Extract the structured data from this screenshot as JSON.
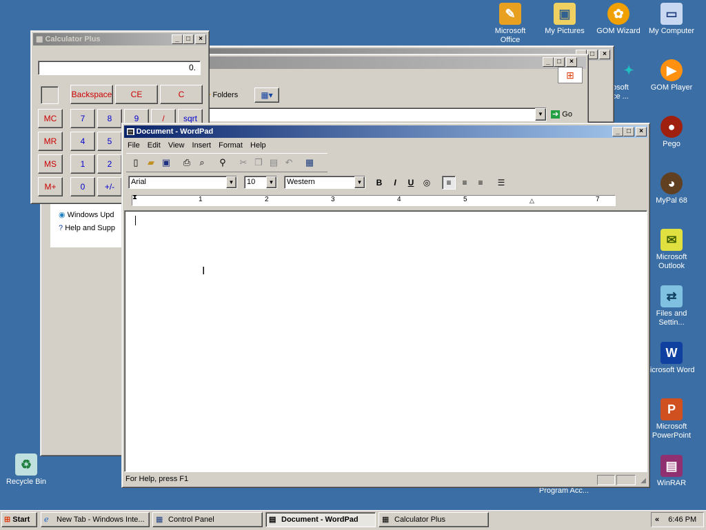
{
  "desktop": {
    "icons": [
      {
        "label": "Microsoft Office",
        "icon": "office-icon"
      },
      {
        "label": "My Pictures",
        "icon": "pictures-folder-icon"
      },
      {
        "label": "GOM Wizard",
        "icon": "gom-wizard-icon"
      },
      {
        "label": "My Computer",
        "icon": "computer-icon"
      },
      {
        "label": "osoft ce ...",
        "icon": "office-icon"
      },
      {
        "label": "GOM Player",
        "icon": "gom-player-icon"
      },
      {
        "label": "Pego",
        "icon": "pego-icon"
      },
      {
        "label": "MyPal 68",
        "icon": "mypal-icon"
      },
      {
        "label": "Microsoft Outlook",
        "icon": "outlook-icon"
      },
      {
        "label": "Files and Settin...",
        "icon": "files-settings-icon"
      },
      {
        "label": "licrosoft Word",
        "icon": "word-icon"
      },
      {
        "label": "Microsoft PowerPoint",
        "icon": "powerpoint-icon"
      },
      {
        "label": "WinRAR",
        "icon": "winrar-icon"
      },
      {
        "label": "Recycle Bin",
        "icon": "recycle-bin-icon"
      },
      {
        "label": "Program Acc...",
        "icon": "program-access-icon"
      }
    ]
  },
  "calculator": {
    "title": "Calculator Plus",
    "display": "0.",
    "buttons": {
      "backspace": "Backspace",
      "ce": "CE",
      "c": "C",
      "mc": "MC",
      "mr": "MR",
      "ms": "MS",
      "mplus": "M+",
      "n7": "7",
      "n8": "8",
      "n9": "9",
      "div": "/",
      "sqrt": "sqrt",
      "n4": "4",
      "n5": "5",
      "n1": "1",
      "n2": "2",
      "n0": "0",
      "sign": "+/-"
    }
  },
  "explorer": {
    "folders_label": "Folders",
    "go_label": "Go",
    "tasks": [
      "Windows Upd",
      "Help and Supp"
    ]
  },
  "wordpad": {
    "title": "Document - WordPad",
    "menu": [
      "File",
      "Edit",
      "View",
      "Insert",
      "Format",
      "Help"
    ],
    "font": "Arial",
    "size": "10",
    "script": "Western",
    "ruler": [
      "1",
      "2",
      "3",
      "4",
      "5",
      "7"
    ],
    "status": "For Help, press F1"
  },
  "taskbar": {
    "start": "Start",
    "items": [
      "New Tab - Windows Inte...",
      "Control Panel",
      "Document - WordPad",
      "Calculator Plus"
    ],
    "clock": "6:46 PM",
    "tray_toggle": "«"
  }
}
